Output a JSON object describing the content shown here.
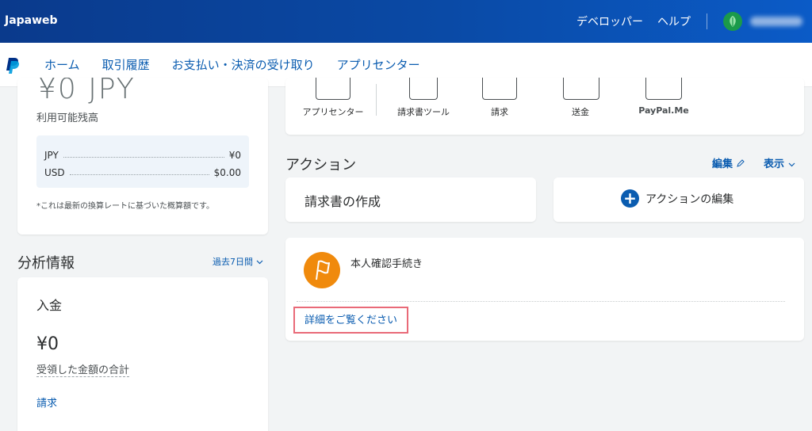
{
  "topbar": {
    "brand": "Japaweb",
    "links": [
      "デベロッパー",
      "ヘルプ"
    ],
    "colors": {
      "bar_start": "#0a3a8c",
      "bar_end": "#0b5bc7",
      "avatar": "#1b9a4a"
    }
  },
  "nav": {
    "logo_icon": "paypal-logo-icon",
    "items": [
      {
        "label": "ホーム",
        "active": true
      },
      {
        "label": "取引履歴",
        "active": false
      },
      {
        "label": "お支払い・決済の受け取り",
        "active": false
      },
      {
        "label": "アプリセンター",
        "active": false
      }
    ],
    "accent": "#0a5cb0"
  },
  "balance": {
    "amount": "¥0 JPY",
    "label": "利用可能残高",
    "currencies": [
      {
        "code": "JPY",
        "value": "¥0"
      },
      {
        "code": "USD",
        "value": "$0.00"
      }
    ],
    "note": "*これは最新の換算レートに基づいた概算額です。"
  },
  "analytics": {
    "title": "分析情報",
    "period": "過去7日間",
    "income": {
      "title": "入金",
      "amount": "¥0",
      "subtitle": "受領した金額の合計",
      "link": "請求"
    }
  },
  "shortcuts": [
    {
      "label": "アプリセンター",
      "icon": "app-center-icon"
    },
    {
      "label": "請求書ツール",
      "icon": "invoice-tool-icon"
    },
    {
      "label": "請求",
      "icon": "request-icon"
    },
    {
      "label": "送金",
      "icon": "send-money-icon"
    },
    {
      "label": "PayPal.Me",
      "icon": "paypal-me-icon"
    }
  ],
  "actions": {
    "title": "アクション",
    "edit": "編集",
    "view": "表示",
    "create_invoice": "請求書の作成",
    "edit_actions": "アクションの編集"
  },
  "verification": {
    "title": "本人確認手続き",
    "link": "詳細をご覧ください",
    "icon": "flag-icon",
    "icon_color": "#f08a0c",
    "highlight_color": "#e96a78"
  }
}
